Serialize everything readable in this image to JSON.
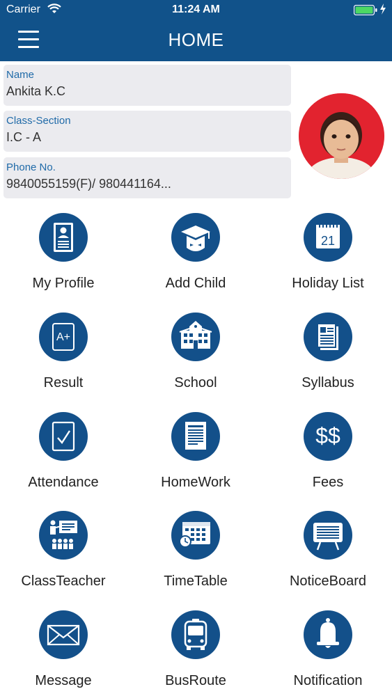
{
  "status_bar": {
    "carrier": "Carrier",
    "time": "11:24 AM"
  },
  "nav": {
    "title": "HOME"
  },
  "student": {
    "name_label": "Name",
    "name": "Ankita K.C",
    "class_label": "Class-Section",
    "class_section": "I.C - A",
    "phone_label": "Phone No.",
    "phone": "9840055159(F)/ 980441164..."
  },
  "menu": [
    {
      "label": "My Profile",
      "icon": "profile-icon"
    },
    {
      "label": "Add Child",
      "icon": "graduate-icon"
    },
    {
      "label": "Holiday List",
      "icon": "calendar-icon",
      "calendar_day": "21"
    },
    {
      "label": "Result",
      "icon": "grade-icon",
      "grade": "A+"
    },
    {
      "label": "School",
      "icon": "school-building-icon"
    },
    {
      "label": "Syllabus",
      "icon": "documents-icon"
    },
    {
      "label": "Attendance",
      "icon": "checkbox-icon"
    },
    {
      "label": "HomeWork",
      "icon": "notebook-icon"
    },
    {
      "label": "Fees",
      "icon": "dollar-icon",
      "symbol": "$$"
    },
    {
      "label": "ClassTeacher",
      "icon": "teacher-icon"
    },
    {
      "label": "TimeTable",
      "icon": "timetable-icon"
    },
    {
      "label": "NoticeBoard",
      "icon": "noticeboard-icon"
    },
    {
      "label": "Message",
      "icon": "envelope-icon"
    },
    {
      "label": "BusRoute",
      "icon": "bus-icon"
    },
    {
      "label": "Notification",
      "icon": "bell-icon"
    }
  ],
  "colors": {
    "primary": "#13508a",
    "nav": "#11528a",
    "label_blue": "#1f6aa8",
    "card_bg": "#ebebef",
    "avatar_bg": "#e2232f"
  }
}
